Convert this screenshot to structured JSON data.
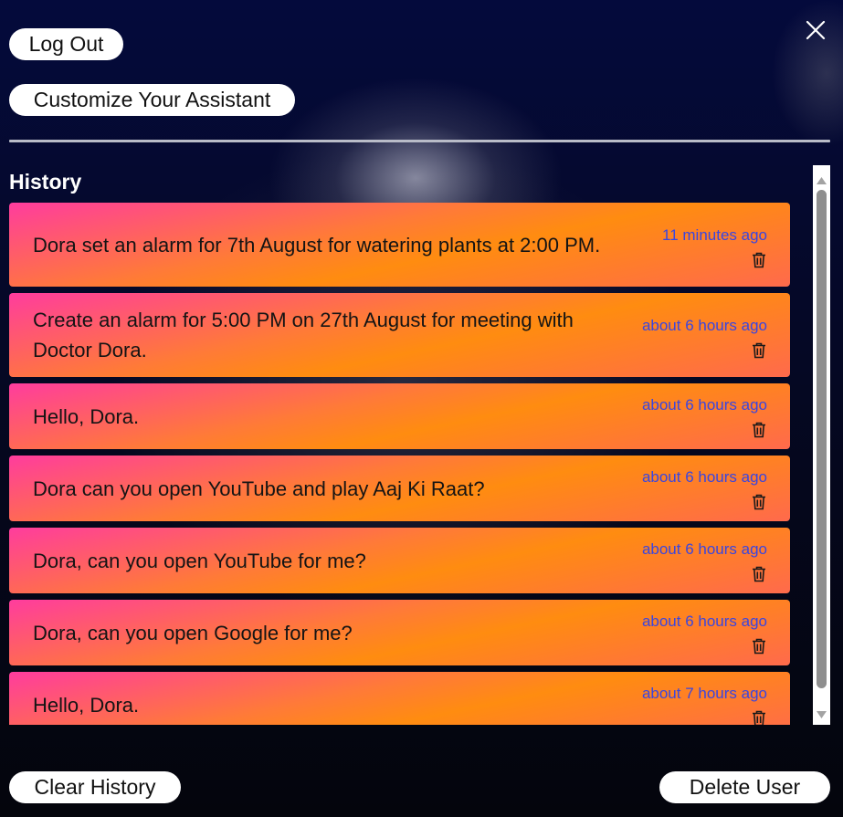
{
  "header": {
    "logout_label": "Log Out",
    "customize_label": "Customize Your Assistant"
  },
  "history": {
    "title": "History",
    "items": [
      {
        "text": "Dora set an alarm for 7th August for watering plants at 2:00 PM.",
        "time": "11 minutes ago"
      },
      {
        "text": "Create an alarm for 5:00 PM on 27th August for meeting with Doctor Dora.",
        "time": "about 6 hours ago"
      },
      {
        "text": "Hello, Dora.",
        "time": "about 6 hours ago"
      },
      {
        "text": "Dora can you open YouTube and play Aaj Ki Raat?",
        "time": "about 6 hours ago"
      },
      {
        "text": "Dora, can you open YouTube for me?",
        "time": "about 6 hours ago"
      },
      {
        "text": "Dora, can you open Google for me?",
        "time": "about 6 hours ago"
      },
      {
        "text": "Hello, Dora.",
        "time": "about 7 hours ago"
      }
    ]
  },
  "footer": {
    "clear_label": "Clear History",
    "delete_label": "Delete User"
  },
  "colors": {
    "card_gradient_start": "#ff3c9e",
    "card_gradient_end": "#ff8c10",
    "timestamp": "#3a46e0",
    "button_bg": "#ffffff"
  },
  "icons": {
    "close": "close-icon",
    "trash": "trash-icon",
    "scroll_up": "chevron-up-icon",
    "scroll_down": "chevron-down-icon"
  }
}
